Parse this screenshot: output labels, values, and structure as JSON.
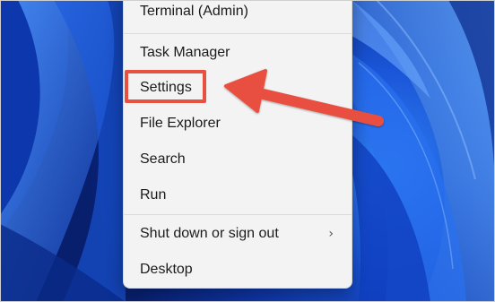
{
  "menu": {
    "items": [
      {
        "label": "Terminal (Admin)"
      },
      {
        "label": "Task Manager"
      },
      {
        "label": "Settings"
      },
      {
        "label": "File Explorer"
      },
      {
        "label": "Search"
      },
      {
        "label": "Run"
      },
      {
        "label": "Shut down or sign out",
        "submenu_indicator": "›"
      },
      {
        "label": "Desktop"
      }
    ]
  },
  "annotation": {
    "highlight_color": "#e8503f",
    "arrow_color": "#e8503f",
    "highlighted_item": "Settings"
  },
  "colors": {
    "menu_background": "#f3f3f3",
    "wallpaper_primary": "#1a56d8"
  }
}
